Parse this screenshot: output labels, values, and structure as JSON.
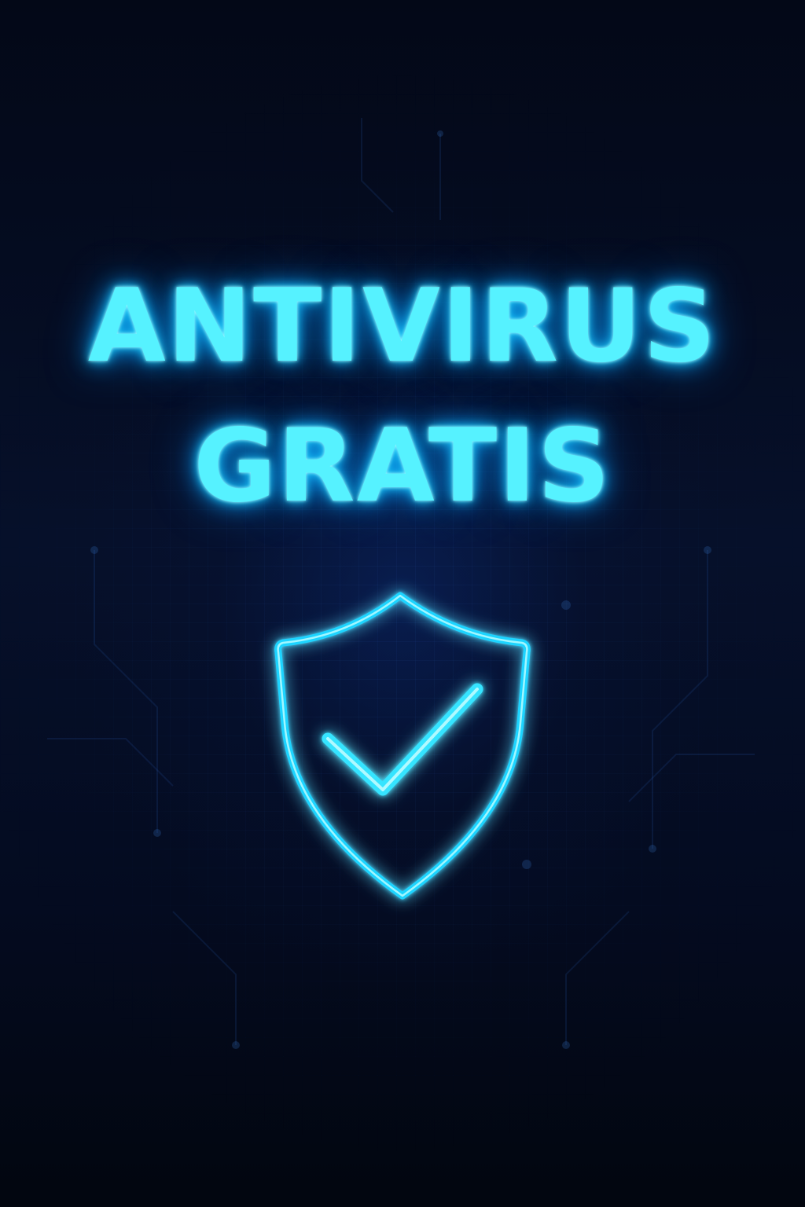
{
  "headline": {
    "line1": "ANTIVIRUS",
    "line2": "GRATIS"
  },
  "icon": {
    "name": "shield-check-icon"
  },
  "colors": {
    "background": "#040a1c",
    "neon": "#56f2ff",
    "glow": "#0aa8ff"
  }
}
